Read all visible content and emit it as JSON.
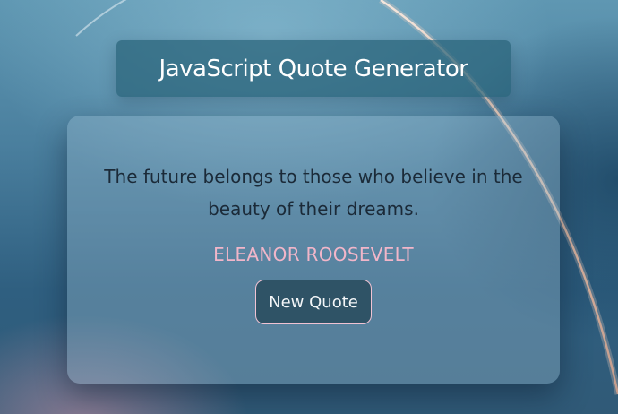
{
  "header": {
    "title": "JavaScript Quote Generator"
  },
  "quote": {
    "text": "The future belongs to those who believe in the beauty of their dreams.",
    "author": "ELEANOR ROOSEVELT"
  },
  "actions": {
    "new_quote_label": "New Quote"
  },
  "colors": {
    "author_accent": "#f2b6c9",
    "button_bg": "#2f5366",
    "button_border": "#f1c3d3",
    "title_box_bg": "#28627a"
  }
}
